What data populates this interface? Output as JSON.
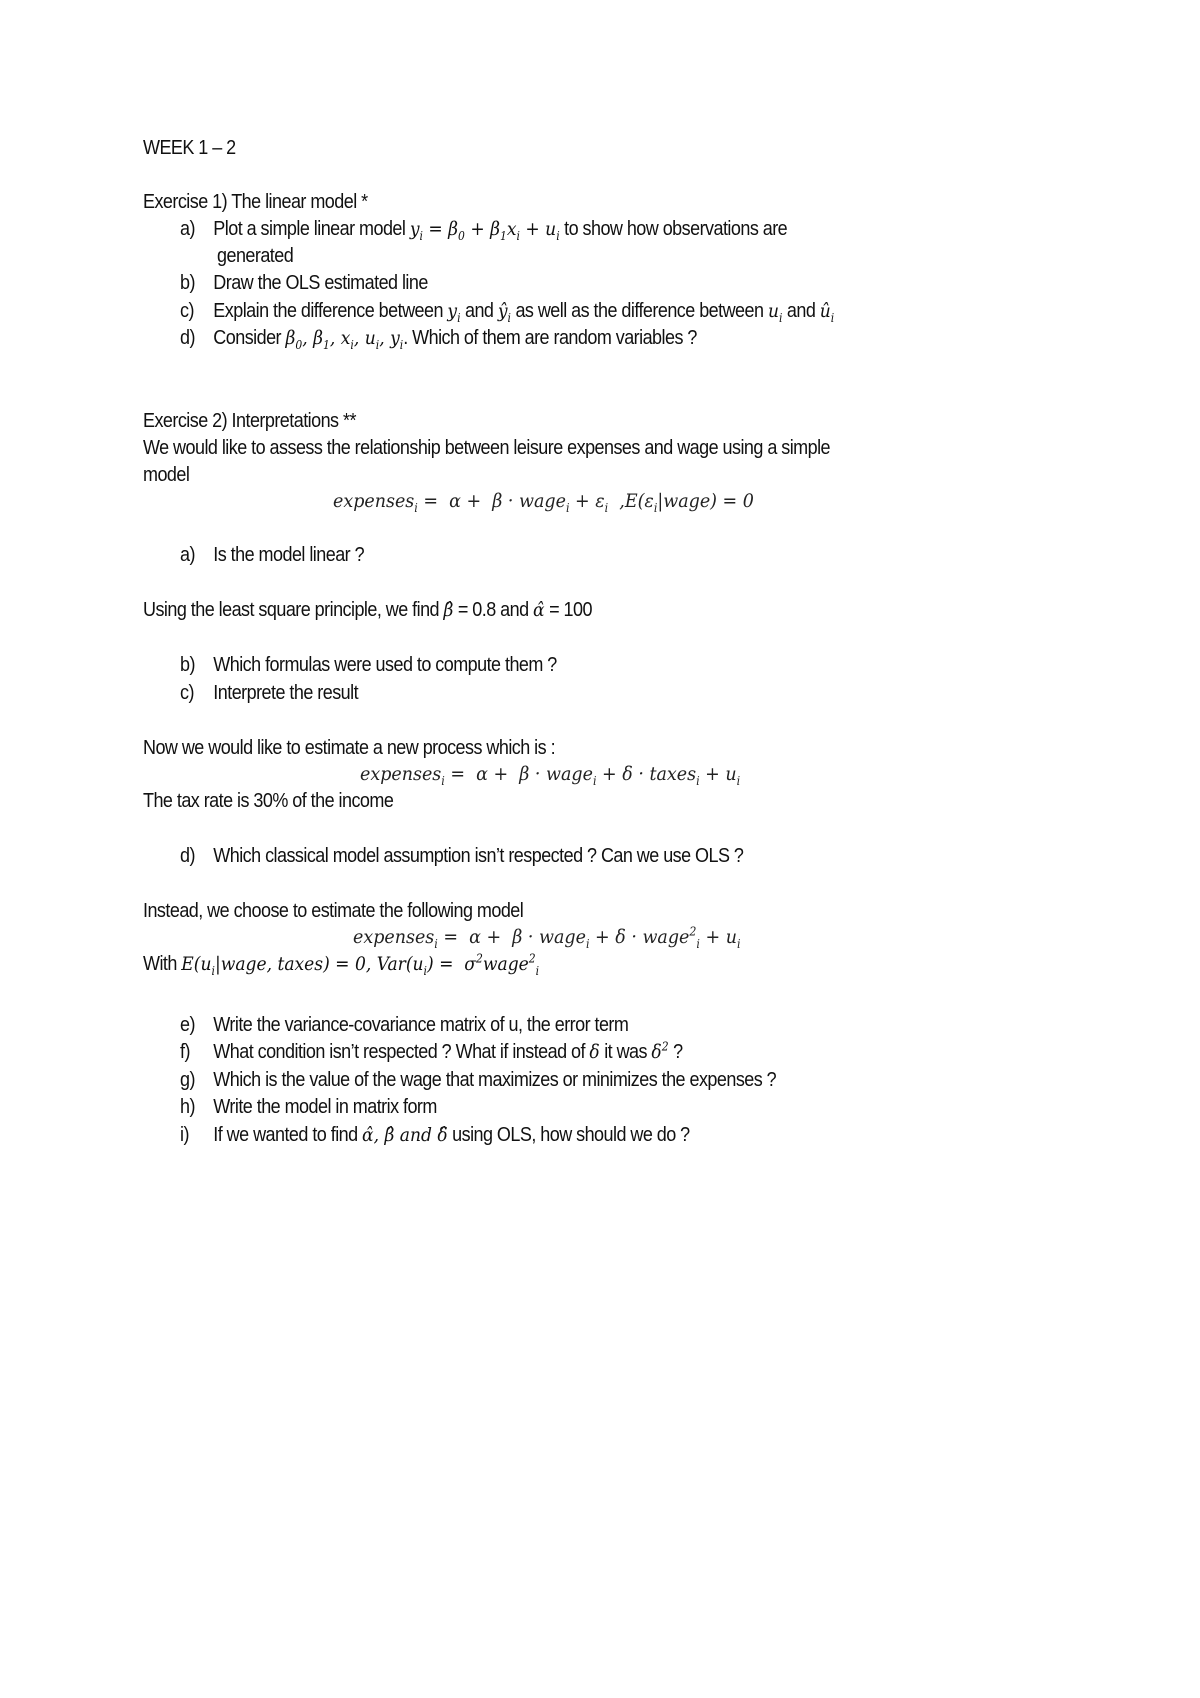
{
  "document": {
    "title": "WEEK 1 – 2",
    "exercise1": {
      "heading": "Exercise 1) The linear model *",
      "items": [
        {
          "label": "a)",
          "text_before": "Plot a simple linear model ",
          "math": "y_i = β_0 + β_1 x_i + u_i",
          "text_after": " to show how observations are",
          "continuation": "generated"
        },
        {
          "label": "b)",
          "text": "Draw the OLS estimated line"
        },
        {
          "label": "c)",
          "text": "Explain the difference between y_i and ŷ_i as well as the difference between u_i and û_i",
          "parts": [
            "Explain the difference between ",
            " and ",
            " as well as the difference between ",
            " and "
          ]
        },
        {
          "label": "d)",
          "text_before": "Consider ",
          "math": "β_0, β_1, x_i, u_i, y_i",
          "text_after": ". Which of them are random variables ?"
        }
      ]
    },
    "exercise2": {
      "heading": "Exercise 2) Interpretations **",
      "intro_line1": "We would like to assess the relationship between leisure expenses and wage using a simple",
      "intro_line2": "model",
      "equation1": "expenses_i = α + β · wage_i + ε_i ,E(ε_i|wage) = 0",
      "item_a": {
        "label": "a)",
        "text": "Is the model linear ?"
      },
      "estimate_text_before": "Using the least square principle, we find ",
      "beta_hat_value": "= 0.8",
      "and": " and ",
      "alpha_hat_value": "= 100",
      "item_b": {
        "label": "b)",
        "text": "Which formulas were used to compute them ?"
      },
      "item_c": {
        "label": "c)",
        "text": "Interprete the result"
      },
      "new_process_text": "Now we would like to estimate a new process which is :",
      "equation2": "expenses_i = α + β · wage_i + δ · taxes_i + u_i",
      "tax_rate_text": "The tax rate is 30% of the income",
      "item_d": {
        "label": "d)",
        "text": "Which classical model assumption isn’t respected ? Can we use OLS ?"
      },
      "instead_text": "Instead, we choose to estimate the following model",
      "equation3": "expenses_i = α + β · wage_i + δ · wage²_i + u_i",
      "with_text": "With ",
      "condition": "E(u_i|wage, taxes) = 0, Var(u_i) = σ²wage²_i",
      "items_e_to_i": [
        {
          "label": "e)",
          "text": "Write the variance-covariance matrix of u, the error term"
        },
        {
          "label": "f)",
          "text_before": "What condition isn’t respected ? What if instead of ",
          "text_mid": " it was ",
          "text_after": " ?"
        },
        {
          "label": "g)",
          "text": "Which is the value of the wage that maximizes or minimizes the expenses ?"
        },
        {
          "label": "h)",
          "text": "Write the model in matrix form"
        },
        {
          "label": "i)",
          "text_before": "If we wanted to find ",
          "text_after": " using OLS, how should we do ?"
        }
      ]
    }
  }
}
